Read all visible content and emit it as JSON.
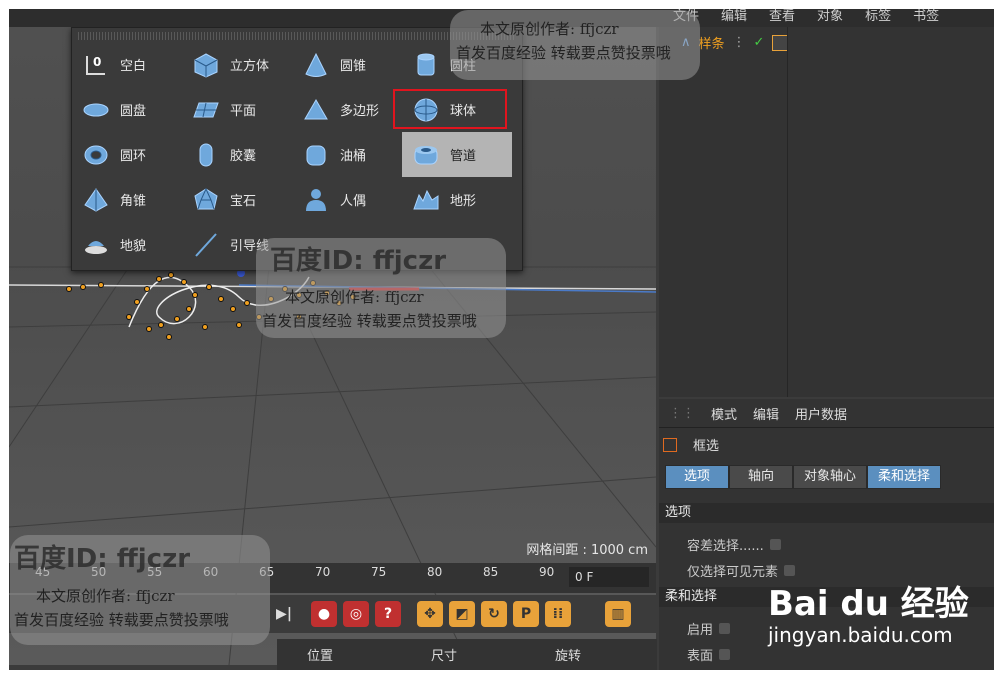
{
  "menubar": [
    "文件",
    "编辑",
    "查看",
    "对象",
    "标签",
    "书签"
  ],
  "popup": {
    "items": [
      {
        "label": "空白",
        "icon": "null-object-icon"
      },
      {
        "label": "立方体",
        "icon": "cube-icon"
      },
      {
        "label": "圆锥",
        "icon": "cone-icon"
      },
      {
        "label": "圆柱",
        "icon": "cylinder-icon"
      },
      {
        "label": "圆盘",
        "icon": "disc-icon"
      },
      {
        "label": "平面",
        "icon": "plane-icon"
      },
      {
        "label": "多边形",
        "icon": "polygon-icon"
      },
      {
        "label": "球体",
        "icon": "sphere-icon"
      },
      {
        "label": "圆环",
        "icon": "torus-icon"
      },
      {
        "label": "胶囊",
        "icon": "capsule-icon"
      },
      {
        "label": "油桶",
        "icon": "oil-tank-icon"
      },
      {
        "label": "管道",
        "icon": "tube-icon"
      },
      {
        "label": "角锥",
        "icon": "pyramid-icon"
      },
      {
        "label": "宝石",
        "icon": "platonic-icon"
      },
      {
        "label": "人偶",
        "icon": "figure-icon"
      },
      {
        "label": "地形",
        "icon": "landscape-icon"
      },
      {
        "label": "地貌",
        "icon": "relief-icon"
      },
      {
        "label": "引导线",
        "icon": "guide-icon"
      }
    ]
  },
  "objects": {
    "spline_name": "样条"
  },
  "viewport": {
    "grid_spacing": "网格间距 : 1000 cm"
  },
  "attributes": {
    "menu": [
      "模式",
      "编辑",
      "用户数据"
    ],
    "mode": "框选",
    "tabs": [
      "选项",
      "轴向",
      "对象轴心",
      "柔和选择"
    ],
    "section_options": "选项",
    "tolerance": "容差选择......",
    "visible_only": "仅选择可见元素",
    "section_soft": "柔和选择",
    "enable": "启用",
    "surface": "表面"
  },
  "timeline": {
    "ticks": [
      "45",
      "50",
      "55",
      "60",
      "65",
      "70",
      "75",
      "80",
      "85",
      "90"
    ],
    "frame": "0 F"
  },
  "coords": [
    "位置",
    "尺寸",
    "旋转"
  ],
  "watermarks": {
    "id": "百度ID: ffjczr",
    "author": "本文原创作者: ffjczr",
    "first": "首发百度经验 转载要点赞投票哦"
  },
  "baidu": {
    "logo": "Bai du 经验",
    "url": "jingyan.baidu.com"
  }
}
